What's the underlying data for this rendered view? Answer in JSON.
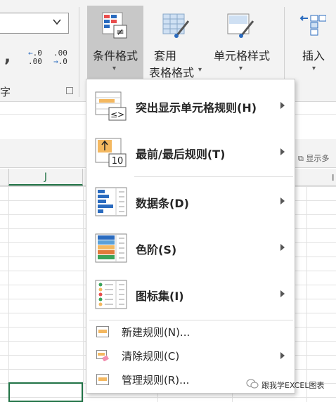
{
  "ribbon": {
    "number_group_label": "字",
    "decimal_increase_top": ".0",
    "decimal_increase_bottom": ".00",
    "decimal_decrease_top": ".00",
    "decimal_decrease_bottom": ".0",
    "comma_symbol": ",",
    "conditional_formatting_label": "条件格式",
    "format_as_table_label_line1": "套用",
    "format_as_table_label_line2": "表格格式",
    "cell_styles_label": "单元格样式",
    "insert_label": "插入"
  },
  "sheet": {
    "column_header": "J",
    "show_more_label": "显示多",
    "right_column_fragment": "I"
  },
  "menu": {
    "items": [
      {
        "label": "突出显示单元格规则(H)",
        "icon": "highlight-cells-rules-icon",
        "has_submenu": true
      },
      {
        "label": "最前/最后规则(T)",
        "icon": "top-bottom-rules-icon",
        "has_submenu": true
      },
      {
        "label": "数据条(D)",
        "icon": "data-bars-icon",
        "has_submenu": true
      },
      {
        "label": "色阶(S)",
        "icon": "color-scales-icon",
        "has_submenu": true
      },
      {
        "label": "图标集(I)",
        "icon": "icon-sets-icon",
        "has_submenu": true
      }
    ],
    "commands": [
      {
        "label": "新建规则(N)...",
        "icon": "new-rule-icon",
        "has_submenu": false
      },
      {
        "label": "清除规则(C)",
        "icon": "clear-rules-icon",
        "has_submenu": true
      },
      {
        "label": "管理规则(R)...",
        "icon": "manage-rules-icon",
        "has_submenu": false
      }
    ],
    "icon_text_le_gt": "≤>",
    "icon_text_10": "10",
    "icon_text_ne": "≠"
  },
  "watermark": {
    "text": "跟我学EXCEL图表"
  },
  "colors": {
    "excel_green": "#217346",
    "ribbon_bg": "#f3f3f3",
    "pressed_button": "#c8c8c8",
    "accent_orange": "#f4b860",
    "accent_blue": "#2a6bbf"
  }
}
